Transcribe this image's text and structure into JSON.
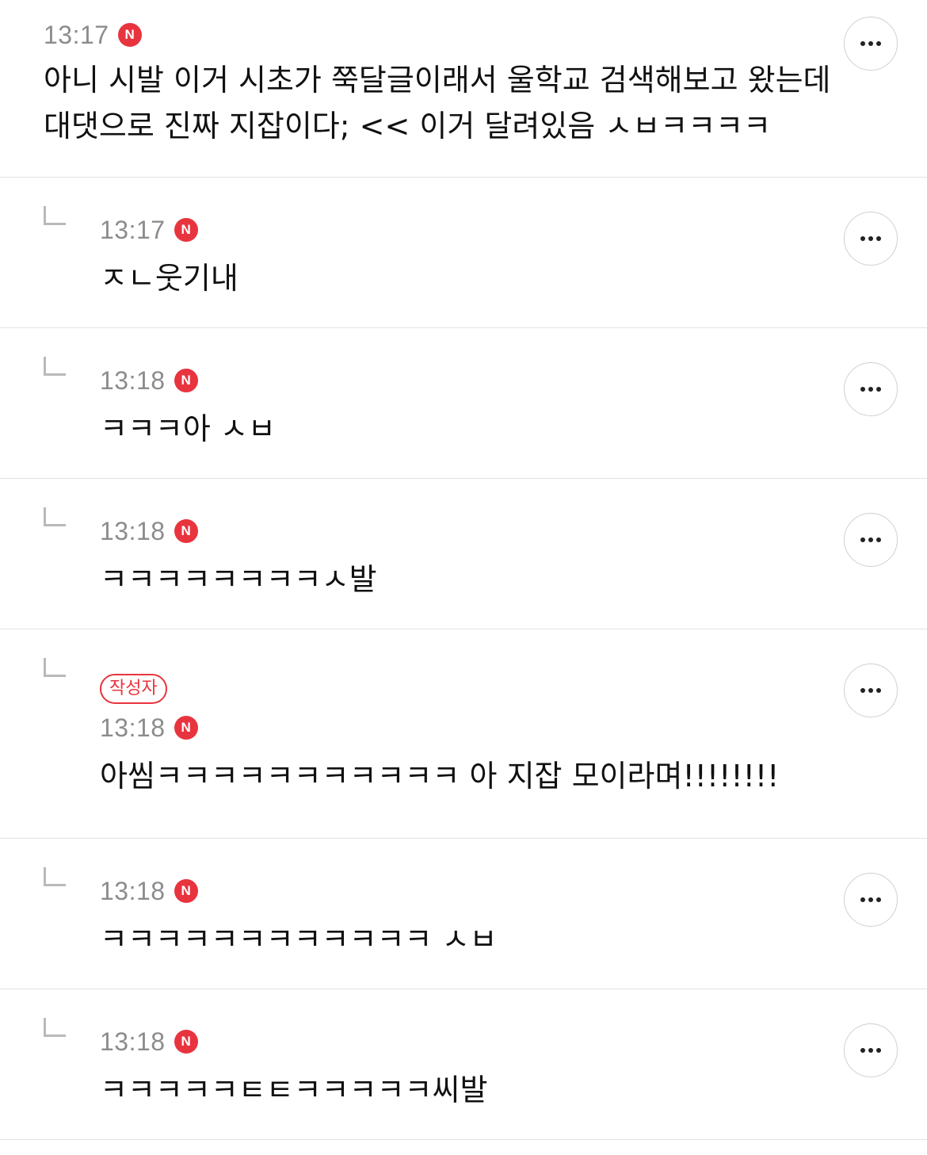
{
  "colors": {
    "accent": "#e8343e",
    "time": "#8c8c8c",
    "divider": "#e2e2e2"
  },
  "comments": [
    {
      "time": "13:17",
      "new_badge": "N",
      "text": "아니 시발 이거 시초가 쭉달글이래서 울학교 검색해보고 왔는데 대댓으로 진짜 지잡이다; << 이거 달려있음 ㅅㅂㅋㅋㅋㅋ"
    },
    {
      "time": "13:17",
      "new_badge": "N",
      "text": "ㅈㄴ웃기내"
    },
    {
      "time": "13:18",
      "new_badge": "N",
      "text": "ㅋㅋㅋ아 ㅅㅂ"
    },
    {
      "time": "13:18",
      "new_badge": "N",
      "text": "ㅋㅋㅋㅋㅋㅋㅋㅋㅅ발"
    },
    {
      "author_badge": "작성자",
      "time": "13:18",
      "new_badge": "N",
      "text": "아씸ㅋㅋㅋㅋㅋㅋㅋㅋㅋㅋㅋ 아 지잡 모이라며!!!!!!!!"
    },
    {
      "time": "13:18",
      "new_badge": "N",
      "text": "ㅋㅋㅋㅋㅋㅋㅋㅋㅋㅋㅋㅋ ㅅㅂ"
    },
    {
      "time": "13:18",
      "new_badge": "N",
      "text": "ㅋㅋㅋㅋㅋㅌㅌㅋㅋㅋㅋㅋ씨발"
    }
  ]
}
